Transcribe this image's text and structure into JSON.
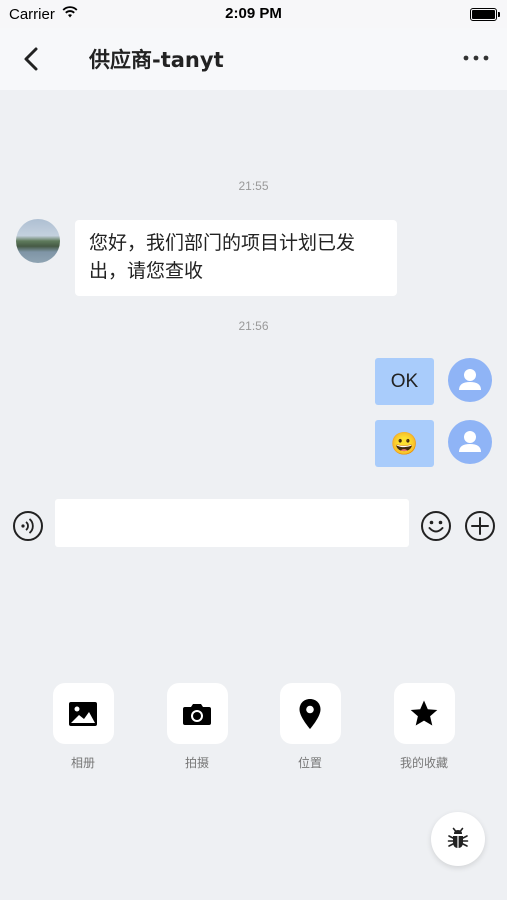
{
  "status_bar": {
    "carrier": "Carrier",
    "time": "2:09 PM"
  },
  "header": {
    "title": "供应商-tanyt"
  },
  "messages": {
    "timestamp_1": "21:55",
    "incoming_text": "您好，我们部门的项目计划已发出，请您查收",
    "timestamp_2": "21:56",
    "outgoing_1_text": "OK",
    "outgoing_2_emoji": "😀"
  },
  "input": {
    "value": "",
    "placeholder": ""
  },
  "tools": [
    {
      "label": "相册",
      "icon": "image-icon"
    },
    {
      "label": "拍摄",
      "icon": "camera-icon"
    },
    {
      "label": "位置",
      "icon": "location-pin-icon"
    },
    {
      "label": "我的收藏",
      "icon": "star-icon"
    }
  ],
  "colors": {
    "background": "#eef0f3",
    "outgoing_bubble": "#a9ccfb",
    "avatar_default": "#8fb4f6",
    "incoming_bubble": "#ffffff"
  }
}
